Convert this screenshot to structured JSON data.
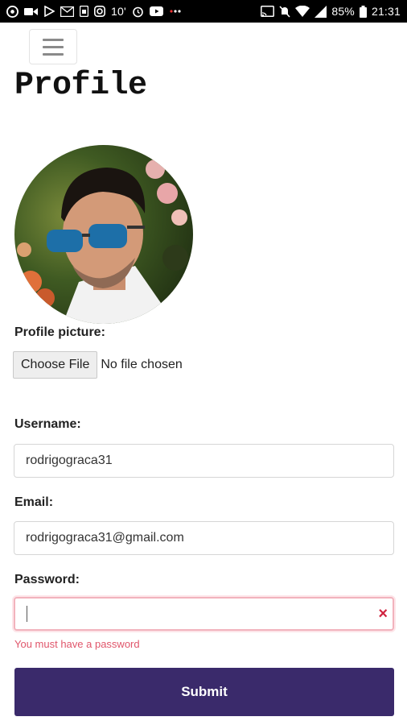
{
  "status_bar": {
    "left_icons": [
      "chrome-icon",
      "video-icon",
      "play-icon",
      "gmail-icon",
      "sim-icon",
      "instagram-icon"
    ],
    "temperature": "10'",
    "mid_icons": [
      "alarm-icon",
      "youtube-icon",
      "dots-icon"
    ],
    "right_icons": [
      "cast-icon",
      "mute-icon",
      "wifi-icon",
      "signal-icon"
    ],
    "battery": "85%",
    "time": "21:31"
  },
  "page": {
    "title": "Profile"
  },
  "profile_picture": {
    "label": "Profile picture:",
    "button_label": "Choose File",
    "status": "No file chosen"
  },
  "username": {
    "label": "Username:",
    "value": "rodrigograca31"
  },
  "email": {
    "label": "Email:",
    "value": "rodrigograca31@gmail.com"
  },
  "password": {
    "label": "Password:",
    "value": "",
    "error_icon": "×",
    "error": "You must have a password"
  },
  "submit": {
    "label": "Submit"
  },
  "colors": {
    "accent": "#3a2a6b",
    "error": "#d0233f"
  }
}
